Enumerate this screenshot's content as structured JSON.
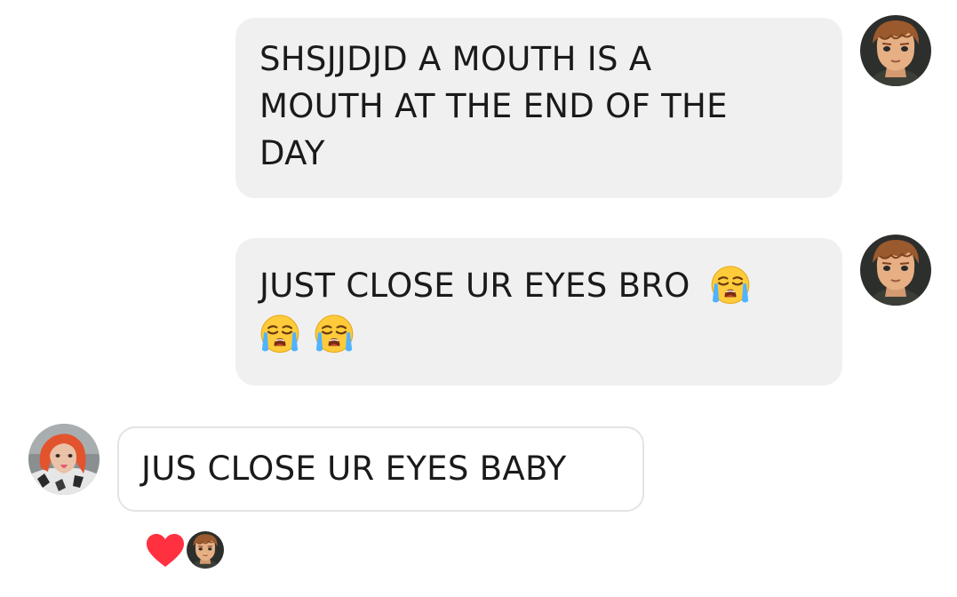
{
  "conversation": {
    "messages": [
      {
        "sender": "other",
        "text_line1": "SHSJJDJD A MOUTH IS A",
        "text_line2": "MOUTH AT THE END OF THE",
        "text_line3": "DAY",
        "avatar_icon": "boy-with-brown-hair-avatar-icon"
      },
      {
        "sender": "other",
        "text_line1": "JUST CLOSE UR EYES BRO",
        "emojis_line1": [
          "loudly-crying-face-icon"
        ],
        "emojis_line2": [
          "loudly-crying-face-icon",
          "loudly-crying-face-icon"
        ],
        "avatar_icon": "boy-with-brown-hair-avatar-icon"
      },
      {
        "sender": "self",
        "text": "JUS CLOSE UR EYES BABY",
        "avatar_icon": "red-haired-girl-avatar-icon",
        "reactions": {
          "icon": "heart-icon",
          "reactor_avatar_icon": "boy-with-brown-hair-avatar-icon"
        }
      }
    ]
  },
  "colors": {
    "sent_bubble_bg": "#f0f0f0",
    "received_bubble_border": "#e3e3e3",
    "text": "#1a1a1a",
    "heart": "#ff3040"
  }
}
